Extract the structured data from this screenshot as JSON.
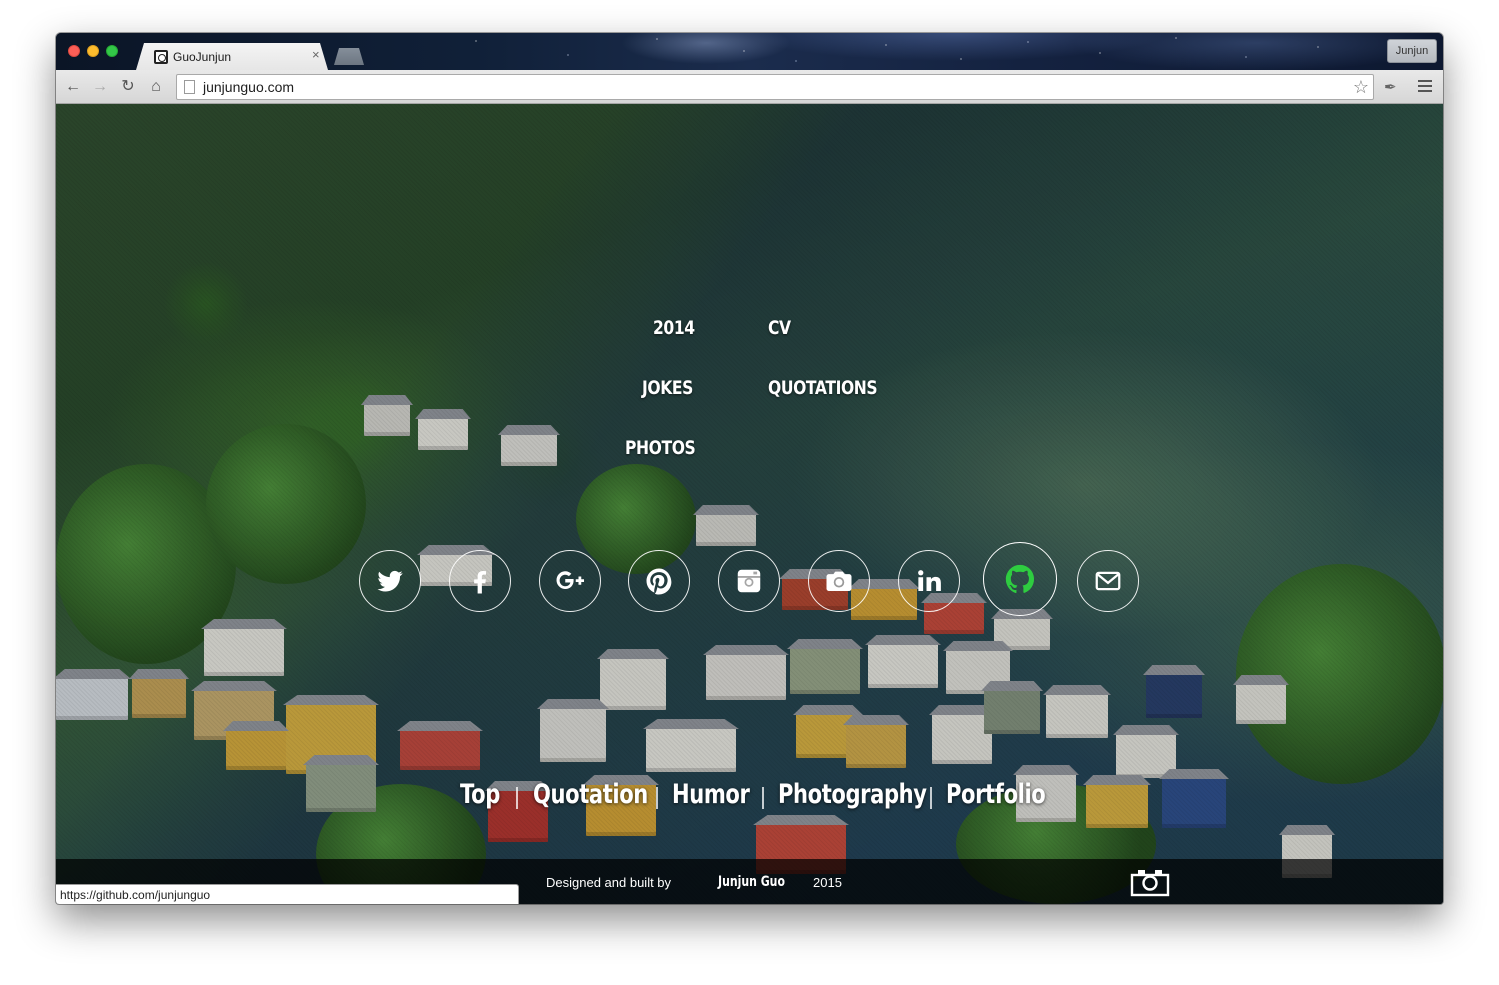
{
  "browser": {
    "tab_title": "GuoJunjun",
    "tab_close": "×",
    "profile_name": "Junjun",
    "url": "junjunguo.com",
    "status_url": "https://github.com/junjunguo"
  },
  "nav": {
    "items": [
      {
        "label": "2014"
      },
      {
        "label": "CV"
      },
      {
        "label": "JOKES"
      },
      {
        "label": "QUOTATIONS"
      },
      {
        "label": "PHOTOS"
      }
    ]
  },
  "social": {
    "items": [
      {
        "icon": "twitter-icon"
      },
      {
        "icon": "facebook-icon"
      },
      {
        "icon": "google-plus-icon"
      },
      {
        "icon": "pinterest-icon"
      },
      {
        "icon": "instagram-icon"
      },
      {
        "icon": "camera-icon"
      },
      {
        "icon": "linkedin-icon"
      },
      {
        "icon": "github-icon"
      },
      {
        "icon": "email-icon"
      }
    ],
    "active_color": "#2ecc40"
  },
  "bottom_menu": {
    "items": [
      {
        "label": "Top"
      },
      {
        "label": "Quotation"
      },
      {
        "label": "Humor"
      },
      {
        "label": "Photography"
      },
      {
        "label": "Portfolio"
      }
    ]
  },
  "footer": {
    "designed_text": "Designed and built by",
    "author": "Junjun Guo",
    "year": "2015"
  }
}
